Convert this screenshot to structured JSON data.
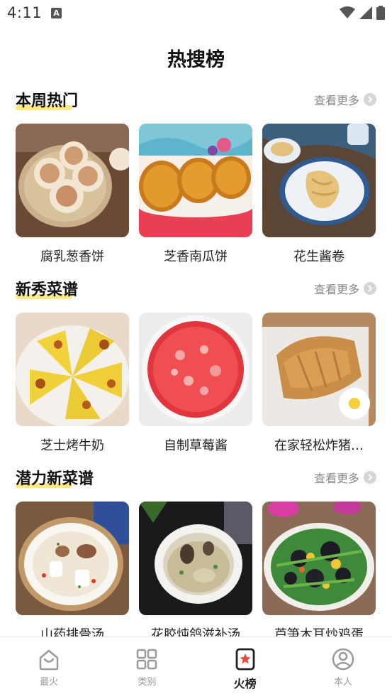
{
  "status_bar": {
    "time": "4:11",
    "notification_icon": "A"
  },
  "page_title": "热搜榜",
  "sections": [
    {
      "title": "本周热门",
      "more_label": "查看更多",
      "items": [
        {
          "title": "腐乳葱香饼"
        },
        {
          "title": "芝香南瓜饼"
        },
        {
          "title": "花生酱卷"
        }
      ]
    },
    {
      "title": "新秀菜谱",
      "more_label": "查看更多",
      "items": [
        {
          "title": "芝士烤牛奶"
        },
        {
          "title": "自制草莓酱"
        },
        {
          "title": "在家轻松炸猪…"
        }
      ]
    },
    {
      "title": "潜力新菜谱",
      "more_label": "查看更多",
      "items": [
        {
          "title": "山药排骨汤"
        },
        {
          "title": "花胶炖鸽滋补汤"
        },
        {
          "title": "芦笋木耳炒鸡蛋"
        }
      ]
    }
  ],
  "tabbar": {
    "items": [
      {
        "label": "最火",
        "icon": "home-icon"
      },
      {
        "label": "类别",
        "icon": "grid-icon"
      },
      {
        "label": "火榜",
        "icon": "star-list-icon",
        "active": true
      },
      {
        "label": "本人",
        "icon": "user-icon"
      }
    ]
  },
  "colors": {
    "accent_underline": "#fde56b",
    "active_star": "#e94b3c",
    "muted": "#9a9a9a"
  }
}
